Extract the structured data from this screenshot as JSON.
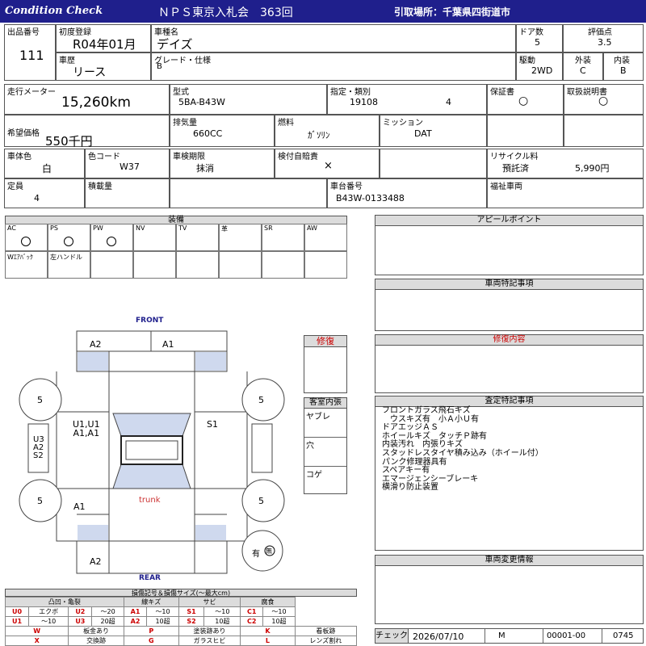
{
  "header": {
    "logo": "Condition  Check",
    "auction_title": "ＮＰＳ東京入札会　363回",
    "pickup": "引取場所：千葉県四街道市"
  },
  "lot": {
    "lot_no_label": "出品番号",
    "lot_no": "111",
    "first_reg_label": "初度登録",
    "first_reg": "R04年01月",
    "car_name_label": "車種名",
    "car_name": "デイズ",
    "doors_label": "ドア数",
    "doors": "5",
    "rating_label": "評価点",
    "rating": "3.5",
    "history_label": "車歴",
    "history": "リース",
    "grade_label": "グレード・仕様",
    "grade": "B",
    "drive_label": "駆動",
    "drive": "2WD",
    "exterior_label": "外装",
    "exterior": "C",
    "interior_label": "内装",
    "interior": "B"
  },
  "specs": {
    "mileage_label": "走行メーター",
    "mileage": "15,260km",
    "model_label": "型式",
    "model": "5BA-B43W",
    "designation_label": "指定・類別",
    "designation": "19108",
    "category": "4",
    "warranty_label": "保証書",
    "warranty": "○",
    "manual_label": "取扱説明書",
    "manual": "○",
    "price_label": "希望価格",
    "price": "550千円",
    "displacement_label": "排気量",
    "displacement": "660CC",
    "fuel_label": "燃料",
    "fuel": "ｶﾞｿﾘﾝ",
    "mission_label": "ミッション",
    "mission": "DAT",
    "color_label": "車体色",
    "color": "白",
    "color_code_label": "色コード",
    "color_code": "W37",
    "inspection_label": "車検期限",
    "inspection": "抹消",
    "liability_label": "検付自賠責",
    "liability": "×",
    "recycle_label": "リサイクル料",
    "recycle_status": "預託済",
    "recycle_fee": "5,990円",
    "capacity_label": "定員",
    "capacity": "4",
    "load_label": "積載量",
    "load": "",
    "chassis_label": "車台番号",
    "chassis": "B43W-0133488",
    "welfare_label": "福祉車両"
  },
  "equipment": {
    "title": "装備",
    "row1": [
      {
        "label": "AC",
        "mark": true
      },
      {
        "label": "PS",
        "mark": true
      },
      {
        "label": "PW",
        "mark": true
      },
      {
        "label": "NV",
        "mark": false
      },
      {
        "label": "TV",
        "mark": false
      },
      {
        "label": "革",
        "mark": false
      },
      {
        "label": "SR",
        "mark": false
      },
      {
        "label": "AW",
        "mark": false
      }
    ],
    "row2": [
      "Wｴｱﾊﾞｯｸ",
      "左ハンドル",
      "",
      "",
      "",
      "",
      "",
      ""
    ]
  },
  "diagram": {
    "front": "FRONT",
    "rear": "REAR",
    "trunk": "trunk",
    "a2_top": "A2",
    "a1_top": "A1",
    "tire_fl": "5",
    "tire_fr": "5",
    "tire_rl": "5",
    "tire_rr": "5",
    "left_door": "U1,U1\nA1,A1",
    "right_door": "S1",
    "side": "U3\nA2\nS2",
    "a1_rear": "A1",
    "a2_bottom": "A2",
    "spare": "有",
    "spare_mark": "無"
  },
  "repair": {
    "title": "修復"
  },
  "cabin": {
    "title": "客室内張",
    "items": [
      "ヤブレ",
      "穴",
      "コゲ"
    ]
  },
  "panels": {
    "appeal": "アピールポイント",
    "special": "車両特記事項",
    "repair_content": "修復内容",
    "inspect": "査定特記事項",
    "inspect_lines": [
      "フロントガラス飛石キズ",
      "　ウスキズ有　小Ａ小Ｕ有",
      "ドアエッジＡＳ",
      "ホイールキズ　タッチＰ跡有",
      "内装汚れ　内張りキズ",
      "スタッドレスタイヤ積み込み（ホイール付）",
      "パンク修理器具有",
      "スペアキー有",
      "エマージェンシーブレーキ",
      "横滑り防止装置"
    ],
    "change": "車両変更情報"
  },
  "footer": {
    "check_label": "チェック",
    "date": "2026/07/10",
    "inspector": "M",
    "code": "00001-00",
    "number": "0745"
  },
  "legend": {
    "title": "損傷記号＆損傷サイズ(〜最大cm)",
    "headers": [
      "凸凹・亀裂",
      "線キズ",
      "サビ",
      "腐食"
    ],
    "row1": [
      "U0",
      "エクボ",
      "U2",
      "〜20",
      "A1",
      "〜10",
      "S1",
      "〜10",
      "C1",
      "〜10"
    ],
    "row2": [
      "U1",
      "〜10",
      "U3",
      "20超",
      "A2",
      "10超",
      "S2",
      "10超",
      "C2",
      "10超"
    ],
    "row3": [
      "W",
      "板金あり",
      "P",
      "塗装跡あり",
      "K",
      "看板跡"
    ],
    "row4": [
      "X",
      "交換跡",
      "G",
      "ガラスヒビ",
      "L",
      "レンズ割れ"
    ]
  }
}
